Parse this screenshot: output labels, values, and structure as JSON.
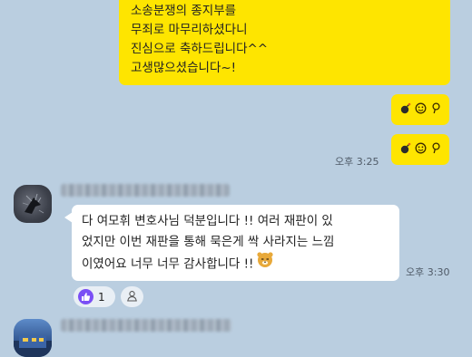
{
  "chat": {
    "my_message": {
      "lines": [
        "소송분쟁의 종지부를",
        "무죄로 마무리하셨다니",
        "진심으로 축하드립니다^^",
        "고생많으셨습니다~!"
      ]
    },
    "emoji_messages": [
      {
        "icons": [
          "bomb-icon",
          "smiley-icon",
          "pin-icon"
        ],
        "glyphs": [
          "💣",
          "ᵕ",
          "♀"
        ]
      },
      {
        "icons": [
          "bomb-icon",
          "smiley-icon",
          "pin-icon"
        ],
        "glyphs": [
          "💣",
          "ᵕ",
          "♀"
        ]
      }
    ],
    "my_time": "오후 3:25",
    "other_message": {
      "lines": [
        "다 여모휘 변호사님 덕분입니다 !! 여러 재판이 있",
        "었지만 이번 재판을 통해 묵은게 싹 사라지는 느낌",
        "이였어요 너무 너무 감사합니다 !!"
      ],
      "sticker": "ryan-sticker-icon",
      "time": "오후 3:30"
    },
    "reactions": {
      "like_count": "1",
      "like_icon": "thumbs-up-icon",
      "add_icon": "add-reaction-icon"
    }
  },
  "colors": {
    "background": "#bacee0",
    "my_bubble": "#fee500",
    "other_bubble": "#ffffff",
    "like_accent": "#7a4ff5"
  }
}
